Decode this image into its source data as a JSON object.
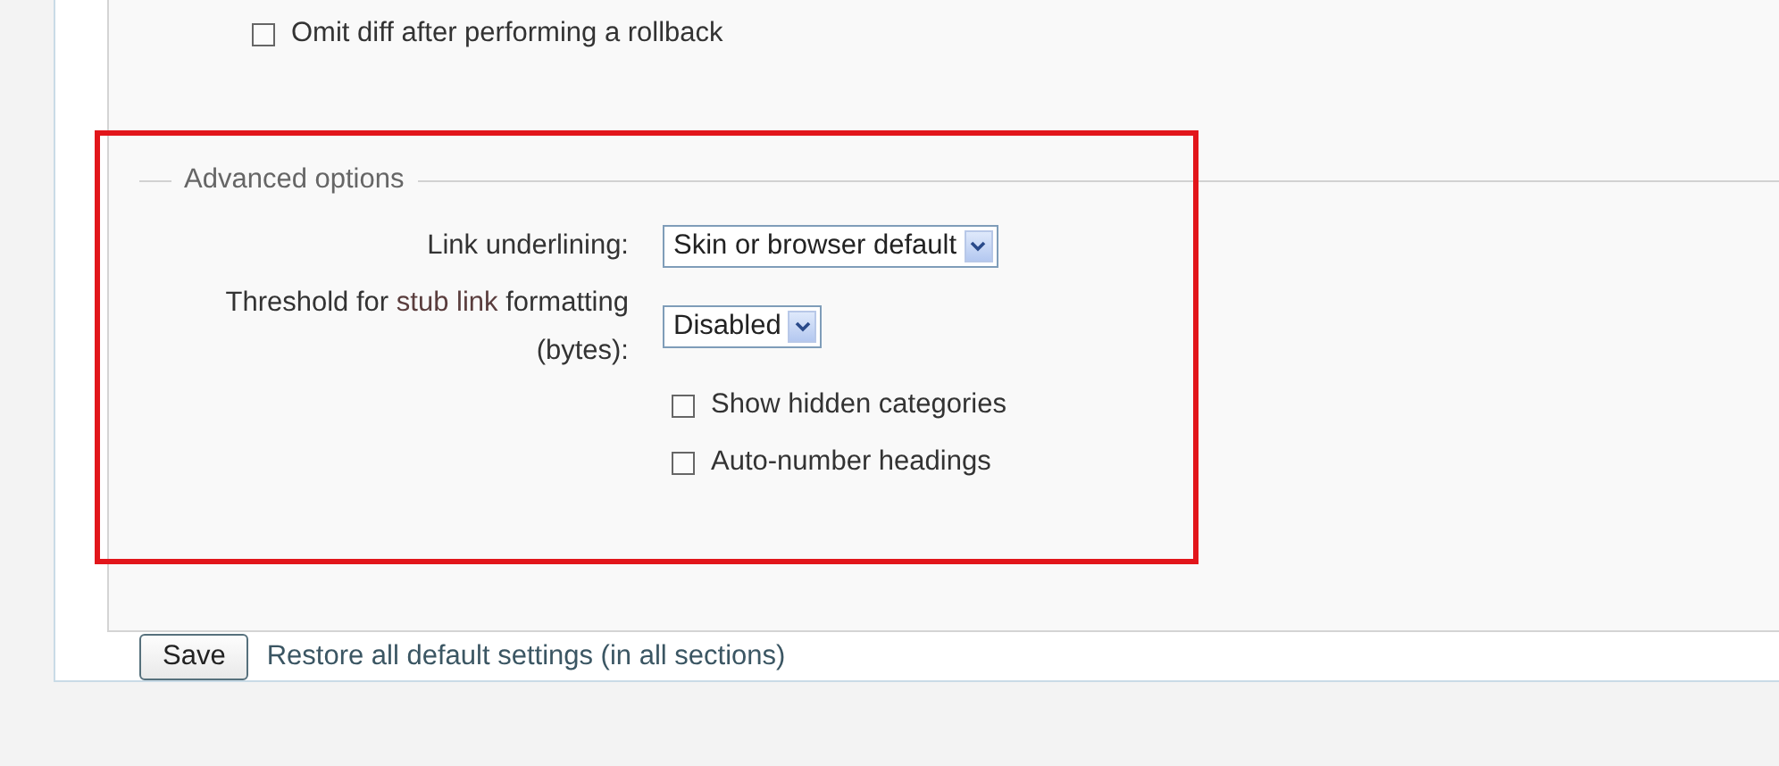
{
  "options": [
    {
      "kind": "checkbox",
      "label": "Omit diff after performing a rollback",
      "checked": false
    }
  ],
  "advanced": {
    "legend": "Advanced options",
    "rows": [
      {
        "kind": "select",
        "label": "Link underlining:",
        "value": "Skin or browser default"
      },
      {
        "kind": "select",
        "label": "Threshold for",
        "label_link": "stub link",
        "label_rest": "formatting (bytes):",
        "value": "Disabled"
      },
      {
        "kind": "checkbox",
        "label": "Show hidden categories",
        "checked": false
      },
      {
        "kind": "checkbox",
        "label": "Auto-number headings",
        "checked": false
      }
    ]
  },
  "highlight": {
    "kind": "rectangle"
  },
  "actions": {
    "save": "Save",
    "restore_link": "Restore all default settings (in all sections)"
  }
}
